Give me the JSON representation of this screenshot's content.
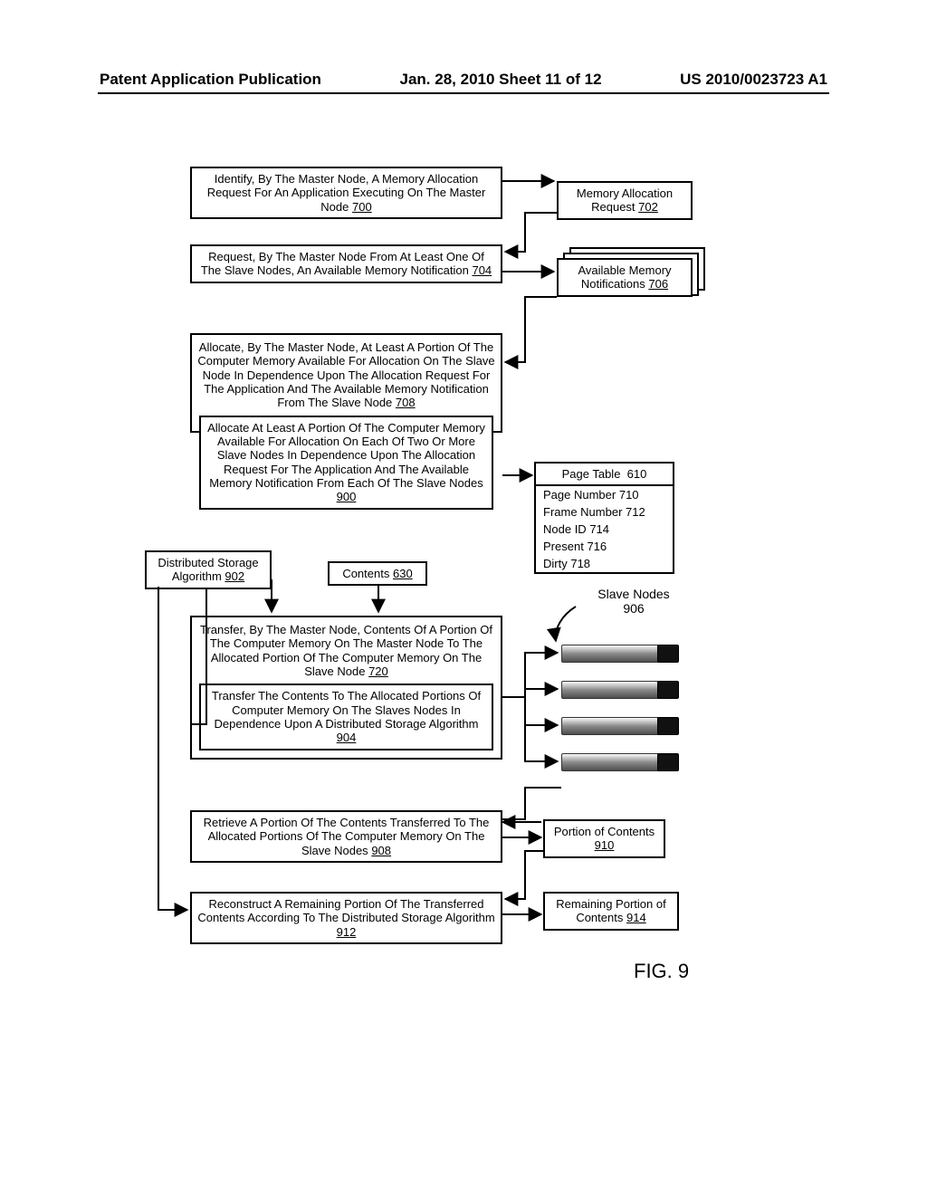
{
  "header": {
    "left": "Patent Application Publication",
    "mid": "Jan. 28, 2010  Sheet 11 of 12",
    "right": "US 2010/0023723 A1"
  },
  "figure_label": "FIG. 9",
  "steps": {
    "s700": {
      "text": "Identify, By The Master Node, A Memory Allocation Request For An Application Executing On The Master Node",
      "ref": "700"
    },
    "s704": {
      "text": "Request, By The Master Node From At Least One Of The Slave Nodes, An Available Memory Notification",
      "ref": "704"
    },
    "s708": {
      "text": "Allocate, By The Master Node, At Least A Portion Of The Computer Memory Available For Allocation On The Slave Node In Dependence Upon The Allocation Request For The Application And The Available Memory Notification From The Slave Node",
      "ref": "708"
    },
    "s900": {
      "text": "Allocate At Least A Portion Of The Computer Memory Available For Allocation On Each Of Two Or More Slave Nodes In Dependence Upon The Allocation Request For The Application And The Available Memory Notification From Each Of The Slave Nodes",
      "ref": "900"
    },
    "s720": {
      "text": "Transfer, By The Master Node, Contents Of A Portion Of The Computer Memory On The Master Node To The Allocated Portion Of The Computer Memory On The Slave Node",
      "ref": "720"
    },
    "s904": {
      "text": "Transfer The Contents To The Allocated Portions Of Computer Memory On The Slaves Nodes In Dependence Upon A Distributed Storage Algorithm",
      "ref": "904"
    },
    "s908": {
      "text": "Retrieve A Portion Of The Contents Transferred To The Allocated Portions Of The Computer Memory On The Slave Nodes",
      "ref": "908"
    },
    "s912": {
      "text": "Reconstruct A Remaining Portion Of The Transferred Contents According To The Distributed Storage Algorithm",
      "ref": "912"
    }
  },
  "aux": {
    "mem_alloc_req": {
      "text": "Memory Allocation Request",
      "ref": "702"
    },
    "avail_mem_notif": {
      "text": "Available Memory Notifications",
      "ref": "706"
    },
    "dist_storage_algo": {
      "text": "Distributed Storage Algorithm",
      "ref": "902"
    },
    "contents": {
      "text": "Contents",
      "ref": "630"
    },
    "page_table": {
      "title": "Page Table",
      "title_ref": "610",
      "rows": [
        {
          "label": "Page Number",
          "ref": "710"
        },
        {
          "label": "Frame Number",
          "ref": "712"
        },
        {
          "label": "Node ID",
          "ref": "714"
        },
        {
          "label": "Present",
          "ref": "716"
        },
        {
          "label": "Dirty",
          "ref": "718"
        }
      ]
    },
    "slave_nodes": {
      "text": "Slave Nodes",
      "ref": "906"
    },
    "portion_contents": {
      "text": "Portion of Contents",
      "ref": "910"
    },
    "remaining_portion": {
      "text": "Remaining Portion of Contents",
      "ref": "914"
    }
  }
}
